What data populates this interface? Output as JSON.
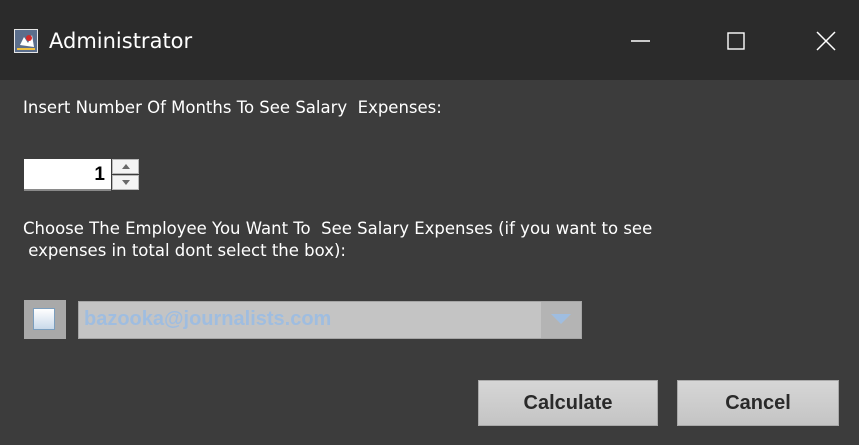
{
  "window": {
    "title": "Administrator",
    "app_icon": "java-app-icon",
    "controls": {
      "minimize_icon": "minimize-icon",
      "maximize_icon": "maximize-icon",
      "close_icon": "close-icon"
    }
  },
  "form": {
    "months_label": "Insert Number Of Months To See Salary  Expenses:",
    "months_value": "1",
    "employee_label_line1": "Choose The Employee You Want To  See Salary Expenses (if you want to see",
    "employee_label_line2": " expenses in total dont select the box):",
    "employee_checkbox_checked": false,
    "employee_selected": "bazooka@journalists.com"
  },
  "buttons": {
    "calculate_label": "Calculate",
    "cancel_label": "Cancel"
  },
  "colors": {
    "window_bg": "#3c3c3c",
    "titlebar_bg": "#2b2b2b",
    "combo_text": "#9fbde0",
    "button_bg": "#cfcfcf"
  }
}
